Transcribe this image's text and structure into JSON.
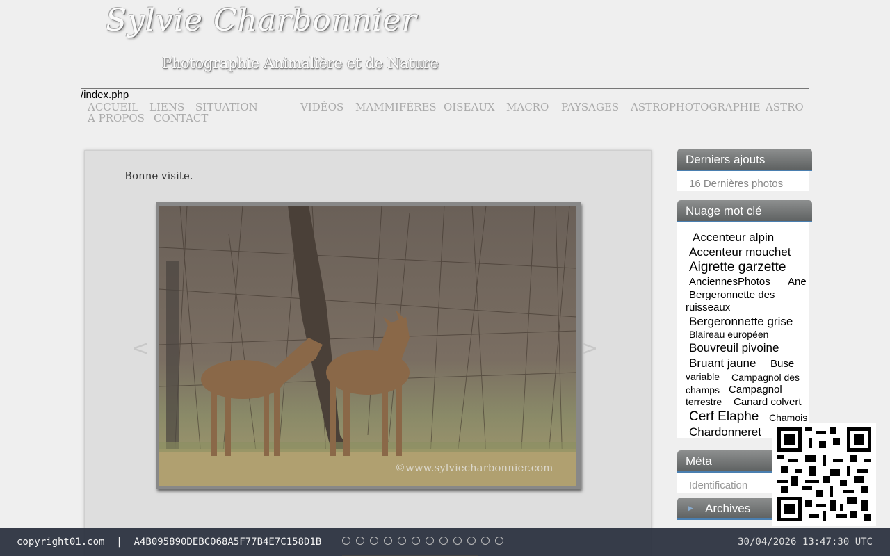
{
  "header": {
    "site_title": "Sylvie Charbonnier",
    "subtitle": "Photographie Animalière et de Nature",
    "path": "/index.php"
  },
  "menu": {
    "row1": [
      "ACCUEIL",
      "LIENS",
      "SITUATION",
      "VIDÉOS",
      "MAMMIFÈRES",
      "OISEAUX",
      "MACRO",
      "PAYSAGES",
      "ASTROPHOTOGRAPHIE",
      "ASTRO"
    ],
    "row2": [
      "A PROPOS",
      "CONTACT"
    ]
  },
  "main": {
    "welcome_text": "Bonne visite.",
    "photo_watermark": "©www.sylviecharbonnier.com",
    "prev_arrow": "<",
    "next_arrow": ">"
  },
  "sidebar": {
    "latest": {
      "title": "Derniers ajouts",
      "link": "16 Dernières photos"
    },
    "tagcloud": {
      "title": "Nuage mot clé",
      "tags": [
        {
          "text": "Accenteur alpin",
          "color": "#5aafc8"
        },
        {
          "text": "Accenteur mouchet",
          "color": "#8a7fb0"
        },
        {
          "text": "Aigrette garzette",
          "color": "#6e5e58"
        },
        {
          "text": "AnciennesPhotos",
          "color": "#b8b8b8"
        },
        {
          "text": "Ane",
          "color": "#6a4aa8"
        },
        {
          "text": "Bergeronnette des",
          "color": "#6a8e2a"
        },
        {
          "text": "ruisseaux",
          "color": "#6a8e2a"
        },
        {
          "text": "Bergeronnette grise",
          "color": "#2f4aa8"
        },
        {
          "text": "Blaireau européen",
          "color": "#b04aaa"
        },
        {
          "text": "Bouvreuil pivoine",
          "color": "#f0c890"
        },
        {
          "text": "Bruant jaune",
          "color": "#9acd32"
        },
        {
          "text": "Buse",
          "color": "#e0c050"
        },
        {
          "text": "variable",
          "color": "#e0c050"
        },
        {
          "text": "Campagnol des",
          "color": "#a0e0c0"
        },
        {
          "text": "champs",
          "color": "#a0e0c0"
        },
        {
          "text": "Campagnol",
          "color": "#2a8a2a"
        },
        {
          "text": "terrestre",
          "color": "#2a8a2a"
        },
        {
          "text": "Canard colvert",
          "color": "#5a1aa8"
        },
        {
          "text": "Cerf Elaphe",
          "color": "#1ad88a"
        },
        {
          "text": "Chamois",
          "color": "#7ac0a8"
        },
        {
          "text": "Chardonneret",
          "color": "#3a8ab0"
        }
      ]
    },
    "meta": {
      "title": "Méta",
      "link": "Identification"
    },
    "archives": {
      "title": "Archives"
    }
  },
  "footer": {
    "left_text": "copyright01.com  |  A4B095890DEBC068A5F77B4E7C158D1B",
    "timestamp": "30/04/2026 13:47:30 UTC"
  }
}
